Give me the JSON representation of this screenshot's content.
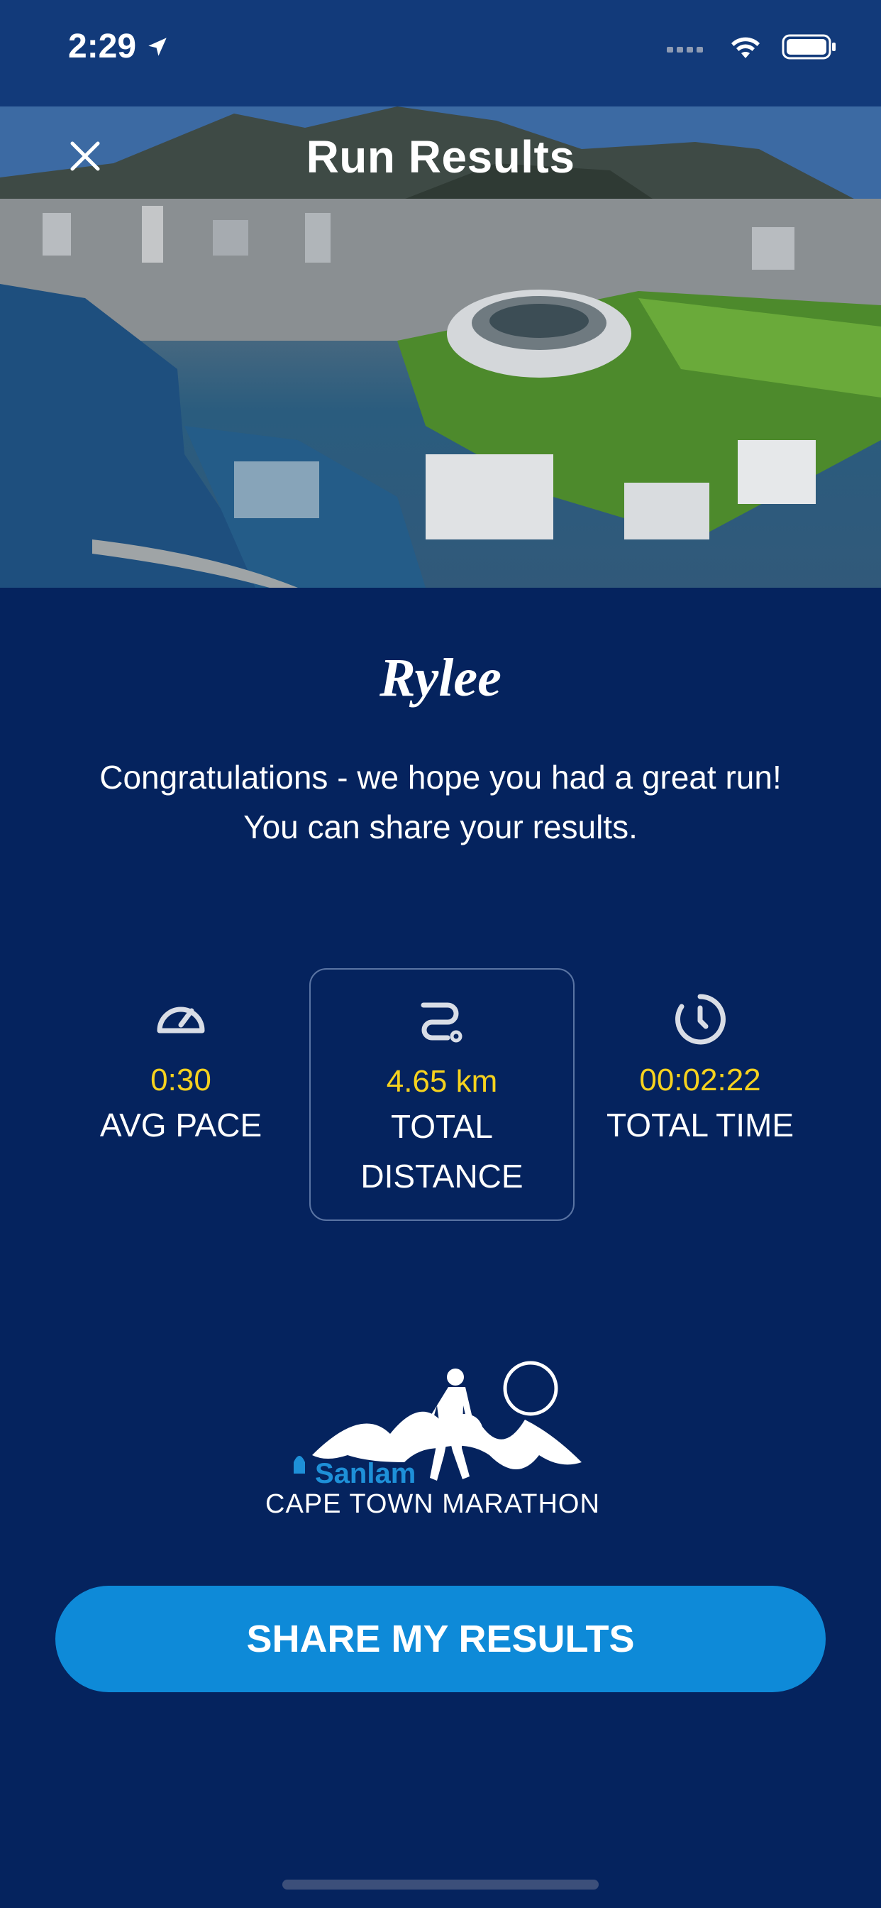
{
  "status_bar": {
    "time": "2:29",
    "icons": [
      "location-arrow-icon",
      "signal-icon",
      "wifi-icon",
      "battery-icon"
    ]
  },
  "header": {
    "title": "Run Results",
    "close_icon": "close-icon"
  },
  "hero_image": "aerial-cape-town-stadium-waterfront",
  "runner": {
    "name": "Rylee"
  },
  "message": {
    "line1": "Congratulations - we hope you had a great run!",
    "line2": "You can share your results."
  },
  "stats": [
    {
      "icon": "speedometer-icon",
      "value": "0:30",
      "label_line1": "AVG PACE",
      "label_line2": ""
    },
    {
      "icon": "route-icon",
      "value": "4.65 km",
      "label_line1": "TOTAL",
      "label_line2": "DISTANCE"
    },
    {
      "icon": "clock-icon",
      "value": "00:02:22",
      "label_line1": "TOTAL TIME",
      "label_line2": ""
    }
  ],
  "logo": {
    "brand": "Sanlam",
    "event": "CAPE TOWN MARATHON"
  },
  "actions": {
    "share_label": "SHARE MY RESULTS"
  },
  "colors": {
    "background": "#05235e",
    "accent_value": "#f6d21e",
    "button": "#0e8ad8",
    "sanlam_blue": "#1e90d8"
  }
}
